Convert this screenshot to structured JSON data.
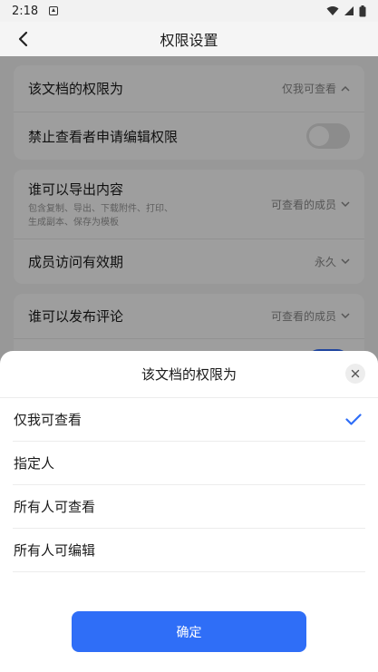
{
  "status_bar": {
    "time": "2:18"
  },
  "header": {
    "title": "权限设置"
  },
  "settings": {
    "doc_permission": {
      "label": "该文档的权限为",
      "value": "仅我可查看"
    },
    "forbid_edit_request": {
      "label": "禁止查看者申请编辑权限",
      "enabled": false
    },
    "export": {
      "label": "谁可以导出内容",
      "sub_line1": "包含复制、导出、下载附件、打印、",
      "sub_line2": "生成副本、保存为模板",
      "value": "可查看的成员"
    },
    "member_expiry": {
      "label": "成员访问有效期",
      "value": "永久"
    },
    "comment": {
      "label": "谁可以发布评论",
      "value": "可查看的成员"
    }
  },
  "sheet": {
    "title": "该文档的权限为",
    "options": [
      {
        "label": "仅我可查看",
        "selected": true
      },
      {
        "label": "指定人",
        "selected": false
      },
      {
        "label": "所有人可查看",
        "selected": false
      },
      {
        "label": "所有人可编辑",
        "selected": false
      }
    ],
    "confirm_label": "确定"
  },
  "colors": {
    "accent": "#2f6ef7",
    "toggle_on": "#3370ff"
  }
}
